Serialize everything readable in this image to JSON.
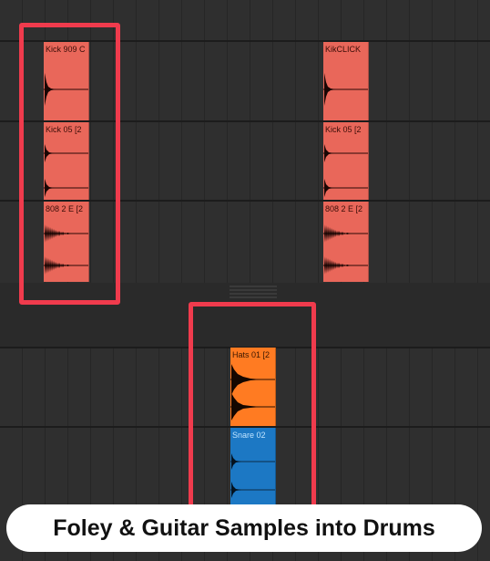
{
  "clips": {
    "left": [
      "Kick 909 C",
      "Kick 05 [2",
      "808 2 E [2"
    ],
    "right": [
      "KikCLICK",
      "Kick 05 [2",
      "808 2 E [2"
    ],
    "hats": "Hats 01 [2",
    "snare": "Snare 02"
  },
  "colors": {
    "kick_clip": "#e9675a",
    "hats_clip": "#ff7b22",
    "snare_clip": "#1c78c4",
    "highlight": "#f03b4d",
    "background": "#2f2f2f"
  },
  "caption": "Foley & Guitar Samples into Drums"
}
